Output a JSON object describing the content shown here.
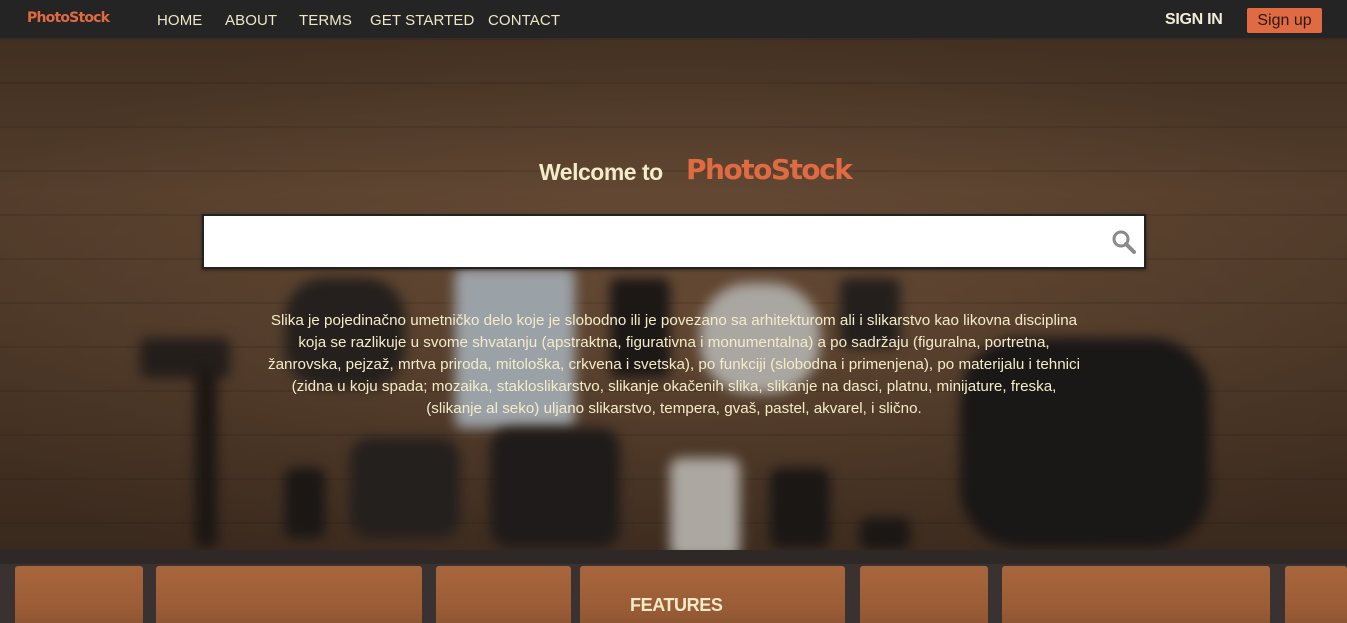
{
  "brand": {
    "name": "PhotoStock",
    "color": "#e06a42"
  },
  "nav": {
    "items": [
      {
        "label": "HOME"
      },
      {
        "label": "ABOUT"
      },
      {
        "label": "TERMS"
      },
      {
        "label": "GET STARTED"
      },
      {
        "label": "CONTACT"
      }
    ],
    "signin_label": "SIGN IN",
    "signup_label": "Sign up"
  },
  "hero": {
    "welcome_text": "Welcome to",
    "brand_text": "PhotoStock",
    "search": {
      "value": "",
      "placeholder": "",
      "icon": "search-icon"
    },
    "description": "Slika je pojedinačno umetničko delo koje je slobodno ili je povezano sa arhitekturom ali i slikarstvo kao likovna disciplina koja se razlikuje u svome shvatanju (apstraktna, figurativna i monumentalna) a po sadržaju (figuralna, portretna, žanrovska, pejzaž, mrtva priroda, mitološka, crkvena i svetska), po funkciji (slobodna i primenjena), po materijalu i tehnici (zidna u koju spada; mozaika, stakloslikarstvo, slikanje okačenih slika, slikanje na dasci, platnu, minijature, freska, (slikanje al seko) uljano slikarstvo, tempera, gvaš, pastel, akvarel, i slično."
  },
  "features": {
    "title": "FEATURES"
  },
  "colors": {
    "navbar": "#242424",
    "accent": "#e06a42",
    "text_light": "#f4ebc9"
  }
}
